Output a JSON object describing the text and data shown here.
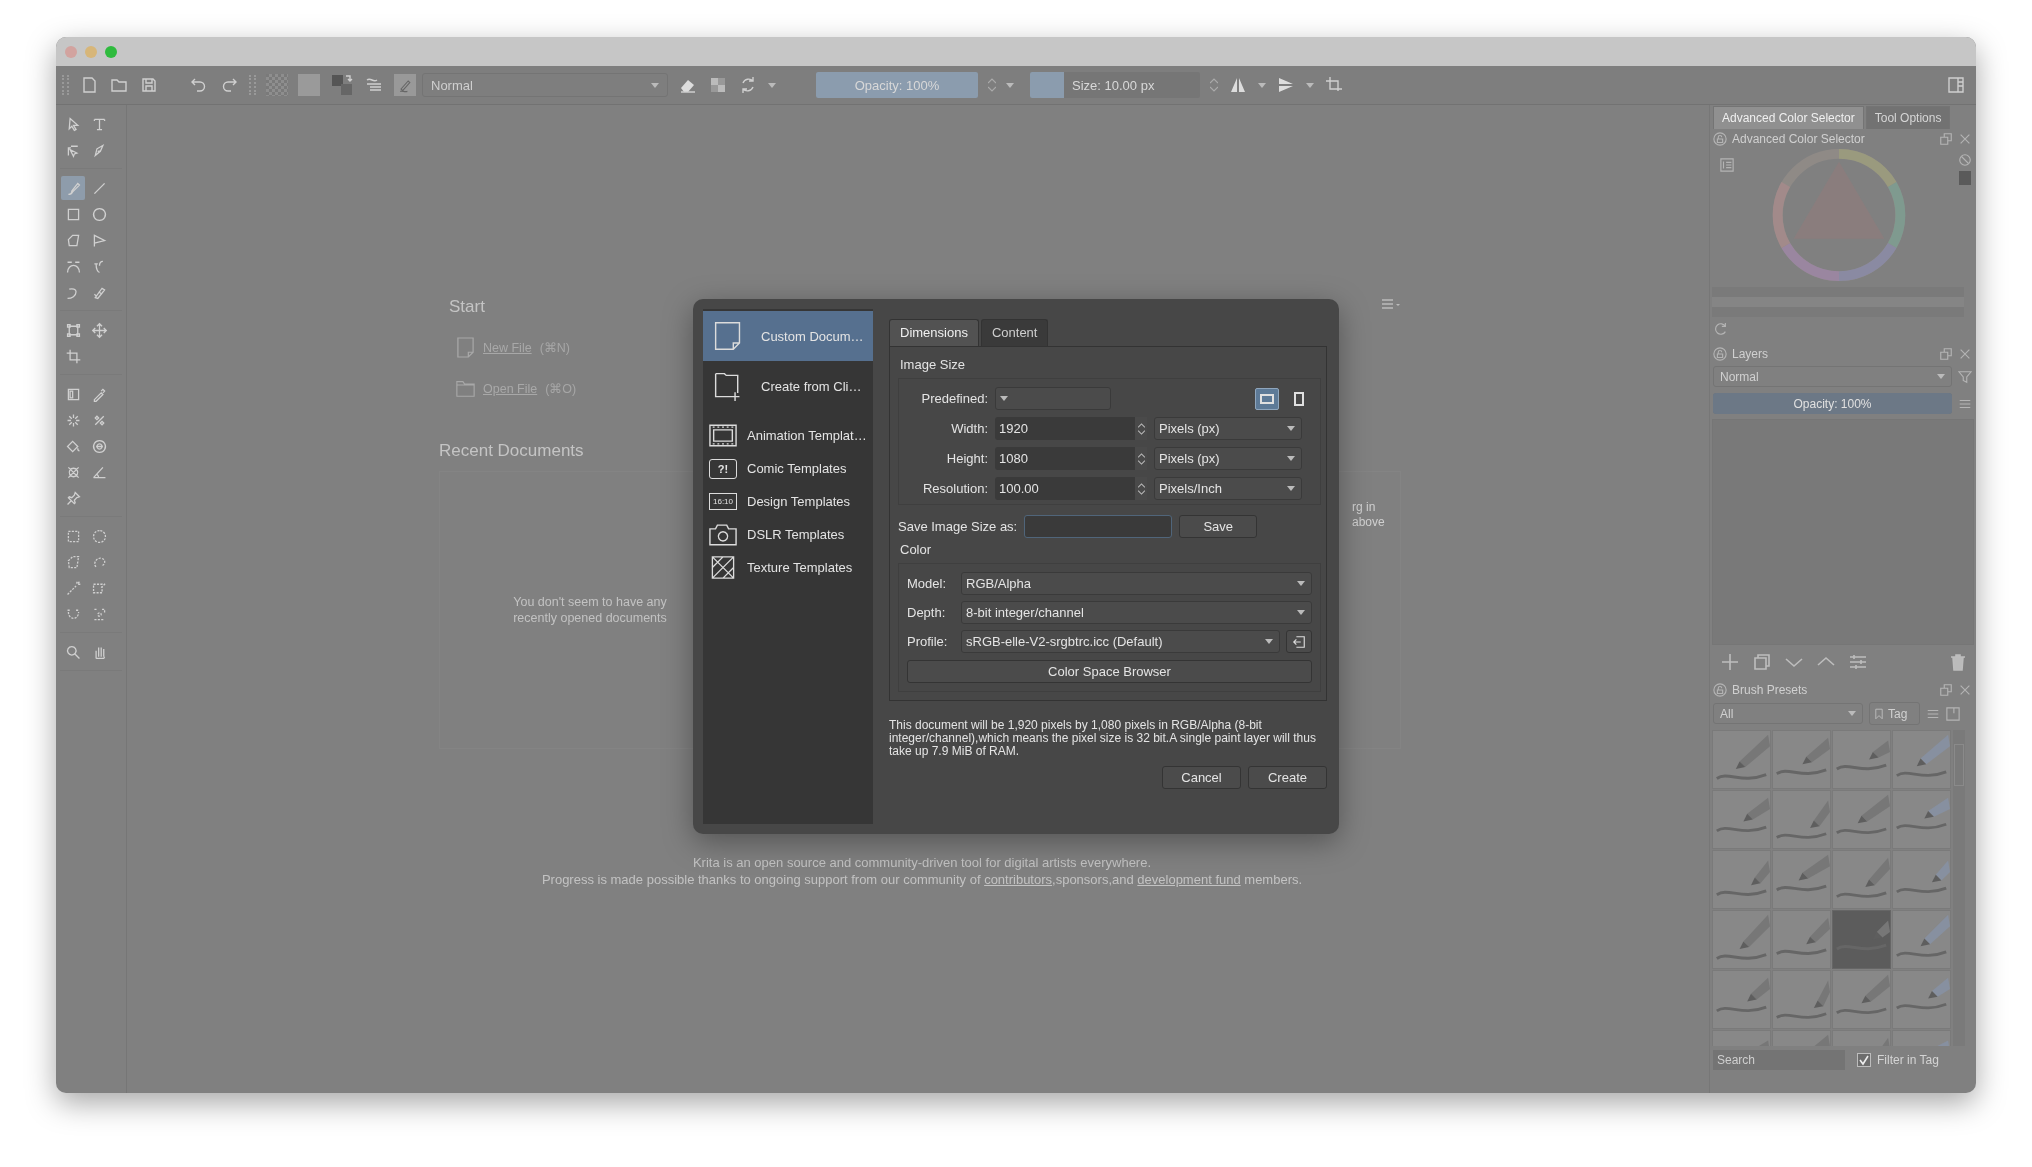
{
  "toolbar": {
    "blend_mode": "Normal",
    "opacity": {
      "label": "Opacity: 100%",
      "level": 1
    },
    "size": {
      "label": "Size: 10.00 px",
      "level": 0.2
    }
  },
  "toolbox": {
    "groups": [
      {
        "tools": [
          {
            "selected": false
          },
          {
            "selected": false
          },
          {
            "selected": false
          },
          {
            "selected": false
          }
        ]
      },
      {
        "tools": [
          {
            "selected": true
          },
          {
            "selected": false
          },
          {
            "selected": false
          },
          {
            "selected": false
          },
          {
            "selected": false
          },
          {
            "selected": false
          },
          {
            "selected": false
          },
          {
            "selected": false
          },
          {
            "selected": false
          },
          {
            "selected": false
          }
        ]
      },
      {
        "tools": [
          {
            "selected": false
          },
          {
            "selected": false
          },
          {
            "selected": false
          }
        ]
      },
      {
        "tools": [
          {
            "selected": false
          },
          {
            "selected": false
          },
          {
            "selected": false
          },
          {
            "selected": false
          },
          {
            "selected": false
          },
          {
            "selected": false
          },
          {
            "selected": false
          },
          {
            "selected": false
          },
          {
            "selected": false
          }
        ]
      },
      {
        "tools": [
          {
            "selected": false
          },
          {
            "selected": false
          },
          {
            "selected": false
          },
          {
            "selected": false
          },
          {
            "selected": false
          },
          {
            "selected": false
          },
          {
            "selected": false
          },
          {
            "selected": false
          }
        ]
      },
      {
        "tools": [
          {
            "selected": false
          },
          {
            "selected": false
          }
        ]
      }
    ]
  },
  "start": {
    "title": "Start",
    "actions": [
      {
        "kind": "new",
        "label": "New File",
        "shortcut": "(⌘N)"
      },
      {
        "kind": "open",
        "label": "Open File",
        "shortcut": "(⌘O)"
      }
    ],
    "recent_title": "Recent Documents",
    "recent_empty": "You don't seem to have any recently opened documents",
    "news_fragments": [
      "rg in",
      "above"
    ]
  },
  "footer": {
    "line_1": "Krita is an open source and community-driven tool for digital artists everywhere.",
    "line_2": {
      "before": "Progress is made possible thanks to ongoing support from our community of ",
      "link_1": "contributors",
      "middle": ",sponsors,and ",
      "link_2": "development fund",
      "after": " members."
    }
  },
  "dialog": {
    "sidebar": [
      {
        "kind": "custom",
        "label": "Custom Docum…",
        "selected": true
      },
      {
        "kind": "clipboard",
        "label": "Create from Cli…",
        "selected": false
      },
      {
        "kind": "animation",
        "label": "Animation Templat…",
        "selected": false
      },
      {
        "kind": "comic",
        "label": "Comic Templates",
        "icon_text": "?!",
        "selected": false
      },
      {
        "kind": "design",
        "label": "Design Templates",
        "icon_text": "16:10",
        "selected": false
      },
      {
        "kind": "dslr",
        "label": "DSLR Templates",
        "selected": false
      },
      {
        "kind": "texture",
        "label": "Texture Templates",
        "selected": false
      }
    ],
    "tabs": [
      {
        "label": "Dimensions",
        "selected": true
      },
      {
        "label": "Content",
        "selected": false
      }
    ],
    "image_size": {
      "title": "Image Size",
      "predefined": {
        "label": "Predefined:"
      },
      "orientation": [
        {
          "kind": "landscape",
          "selected": true
        },
        {
          "kind": "portrait",
          "selected": false
        }
      ],
      "fields": [
        {
          "label": "Width:",
          "value": "1920",
          "unit": "Pixels (px)"
        },
        {
          "label": "Height:",
          "value": "1080",
          "unit": "Pixels (px)"
        },
        {
          "label": "Resolution:",
          "value": "100.00",
          "unit": "Pixels/Inch"
        }
      ]
    },
    "save_as": {
      "label": "Save Image Size as:",
      "button": "Save"
    },
    "color": {
      "title": "Color",
      "rows": [
        {
          "label": "Model:",
          "value": "RGB/Alpha"
        },
        {
          "label": "Depth:",
          "value": "8-bit integer/channel"
        },
        {
          "label": "Profile:",
          "value": "sRGB-elle-V2-srgbtrc.icc (Default)"
        }
      ],
      "browser_button": "Color Space Browser"
    },
    "description": "This document will be 1,920 pixels by 1,080 pixels in RGB/Alpha (8-bit integer/channel),which means the pixel size is 32 bit.A single paint layer will thus take up 7.9 MiB of RAM.",
    "buttons": [
      "Cancel",
      "Create"
    ]
  },
  "dock": {
    "tabs": [
      {
        "label": "Advanced Color Selector",
        "selected": true
      },
      {
        "label": "Tool Options",
        "selected": false
      }
    ],
    "color_selector": {
      "title": "Advanced Color Selector"
    },
    "layers": {
      "title": "Layers",
      "blend_mode": "Normal",
      "opacity": {
        "label": "Opacity:  100%",
        "level": 1
      }
    },
    "brush_presets": {
      "title": "Brush Presets",
      "filter": "All",
      "tag": "Tag",
      "search_placeholder": "Search",
      "filter_in_tag": {
        "label": "Filter in Tag",
        "checked": true
      },
      "items": [
        {
          "selected": false
        },
        {
          "selected": false
        },
        {
          "selected": false
        },
        {
          "selected": false
        },
        {
          "selected": false
        },
        {
          "selected": false
        },
        {
          "selected": false
        },
        {
          "selected": false
        },
        {
          "selected": false
        },
        {
          "selected": false
        },
        {
          "selected": false
        },
        {
          "selected": false
        },
        {
          "selected": false
        },
        {
          "selected": false
        },
        {
          "selected": true
        },
        {
          "selected": false
        },
        {
          "selected": false
        },
        {
          "selected": false
        },
        {
          "selected": false
        },
        {
          "selected": false
        },
        {
          "selected": false
        },
        {
          "selected": false
        },
        {
          "selected": false
        },
        {
          "selected": false
        }
      ]
    }
  }
}
